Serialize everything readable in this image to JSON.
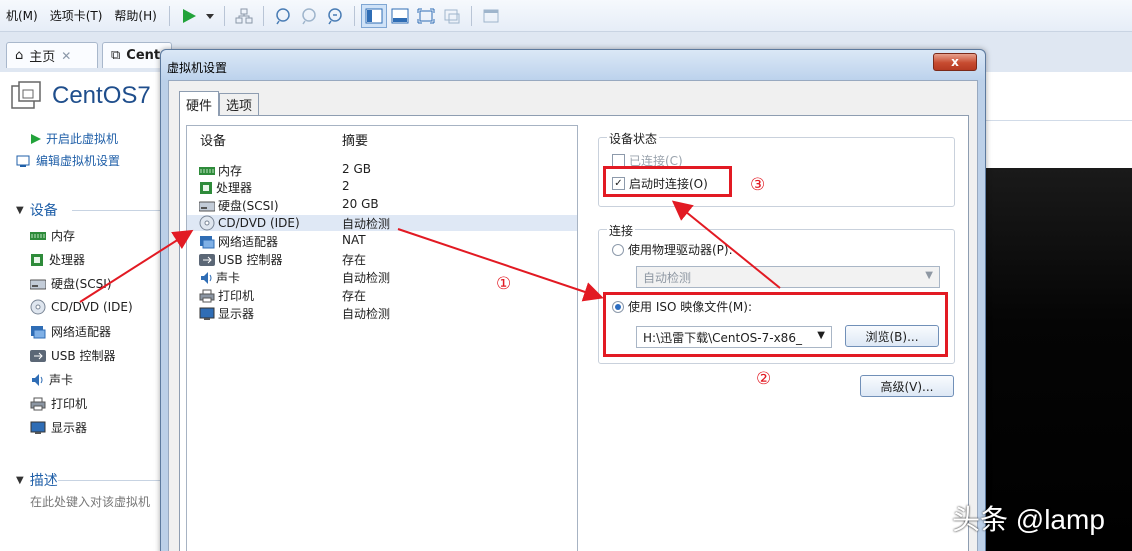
{
  "menubar": {
    "items": [
      "机(M)",
      "选项卡(T)",
      "帮助(H)"
    ]
  },
  "tabs": {
    "home": "主页",
    "vm": "Cent"
  },
  "vm_panel": {
    "name": "CentOS7",
    "actions": [
      "开启此虚拟机",
      "编辑虚拟机设置"
    ],
    "devices_header": "设备",
    "devices": [
      "内存",
      "处理器",
      "硬盘(SCSI)",
      "CD/DVD (IDE)",
      "网络适配器",
      "USB 控制器",
      "声卡",
      "打印机",
      "显示器"
    ],
    "desc_header": "描述",
    "desc_placeholder": "在此处键入对该虚拟机"
  },
  "dialog": {
    "title": "虚拟机设置",
    "close": "x",
    "tabs": [
      "硬件",
      "选项"
    ],
    "list_headers": {
      "device": "设备",
      "summary": "摘要"
    },
    "rows": [
      {
        "name": "内存",
        "summary": "2 GB"
      },
      {
        "name": "处理器",
        "summary": "2"
      },
      {
        "name": "硬盘(SCSI)",
        "summary": "20 GB"
      },
      {
        "name": "CD/DVD (IDE)",
        "summary": "自动检测"
      },
      {
        "name": "网络适配器",
        "summary": "NAT"
      },
      {
        "name": "USB 控制器",
        "summary": "存在"
      },
      {
        "name": "声卡",
        "summary": "自动检测"
      },
      {
        "name": "打印机",
        "summary": "存在"
      },
      {
        "name": "显示器",
        "summary": "自动检测"
      }
    ],
    "device_status": {
      "title": "设备状态",
      "connected": "已连接(C)",
      "connect_on_power": "启动时连接(O)"
    },
    "connection": {
      "title": "连接",
      "physical": "使用物理驱动器(P):",
      "physical_value": "自动检测",
      "iso": "使用 ISO 映像文件(M):",
      "iso_value": "H:\\迅雷下载\\CentOS-7-x86_",
      "browse": "浏览(B)..."
    },
    "advanced": "高级(V)..."
  },
  "annotations": [
    "①",
    "②",
    "③"
  ],
  "watermark": "头条 @lamp",
  "colors": {
    "annotation_red": "#e21a23",
    "link_blue": "#1f5fa8"
  }
}
